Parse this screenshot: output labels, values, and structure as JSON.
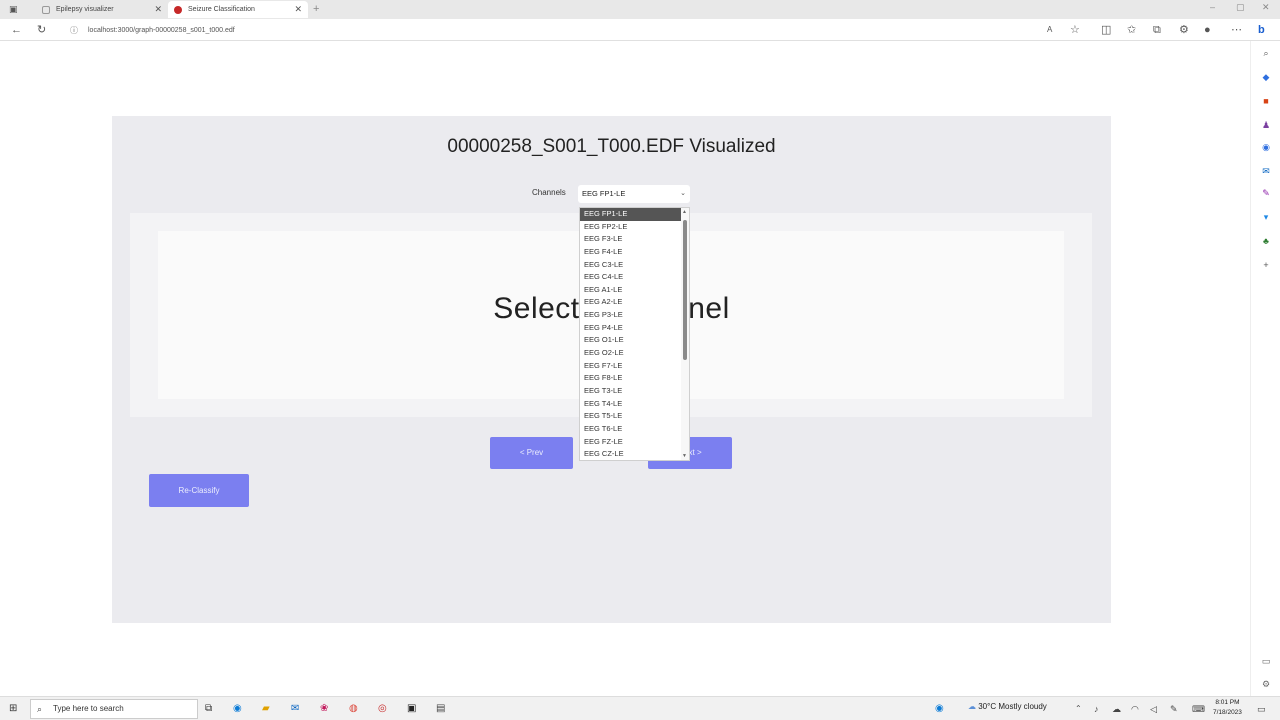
{
  "browser": {
    "tabs": [
      {
        "title": "Epilepsy visualizer",
        "active": false
      },
      {
        "title": "Seizure Classification",
        "active": true
      }
    ],
    "new_tab": "+",
    "url": "localhost:3000/graph-00000258_s001_t000.edf"
  },
  "page": {
    "title": "00000258_S001_T000.EDF Visualized",
    "channels_label": "Channels",
    "selected_channel": "EEG FP1-LE",
    "select_message": "Select a Channel",
    "prev_label": "< Prev",
    "next_label": "Next >",
    "reclassify_label": "Re-Classify",
    "accent_color": "#7b7ff0"
  },
  "dropdown": {
    "options": [
      "EEG FP1-LE",
      "EEG FP2-LE",
      "EEG F3-LE",
      "EEG F4-LE",
      "EEG C3-LE",
      "EEG C4-LE",
      "EEG A1-LE",
      "EEG A2-LE",
      "EEG P3-LE",
      "EEG P4-LE",
      "EEG O1-LE",
      "EEG O2-LE",
      "EEG F7-LE",
      "EEG F8-LE",
      "EEG T3-LE",
      "EEG T4-LE",
      "EEG T5-LE",
      "EEG T6-LE",
      "EEG FZ-LE",
      "EEG CZ-LE"
    ],
    "highlighted_index": 0
  },
  "taskbar": {
    "search_placeholder": "Type here to search",
    "weather": "30°C  Mostly cloudy",
    "time": "8:01 PM",
    "date": "7/18/2023"
  }
}
